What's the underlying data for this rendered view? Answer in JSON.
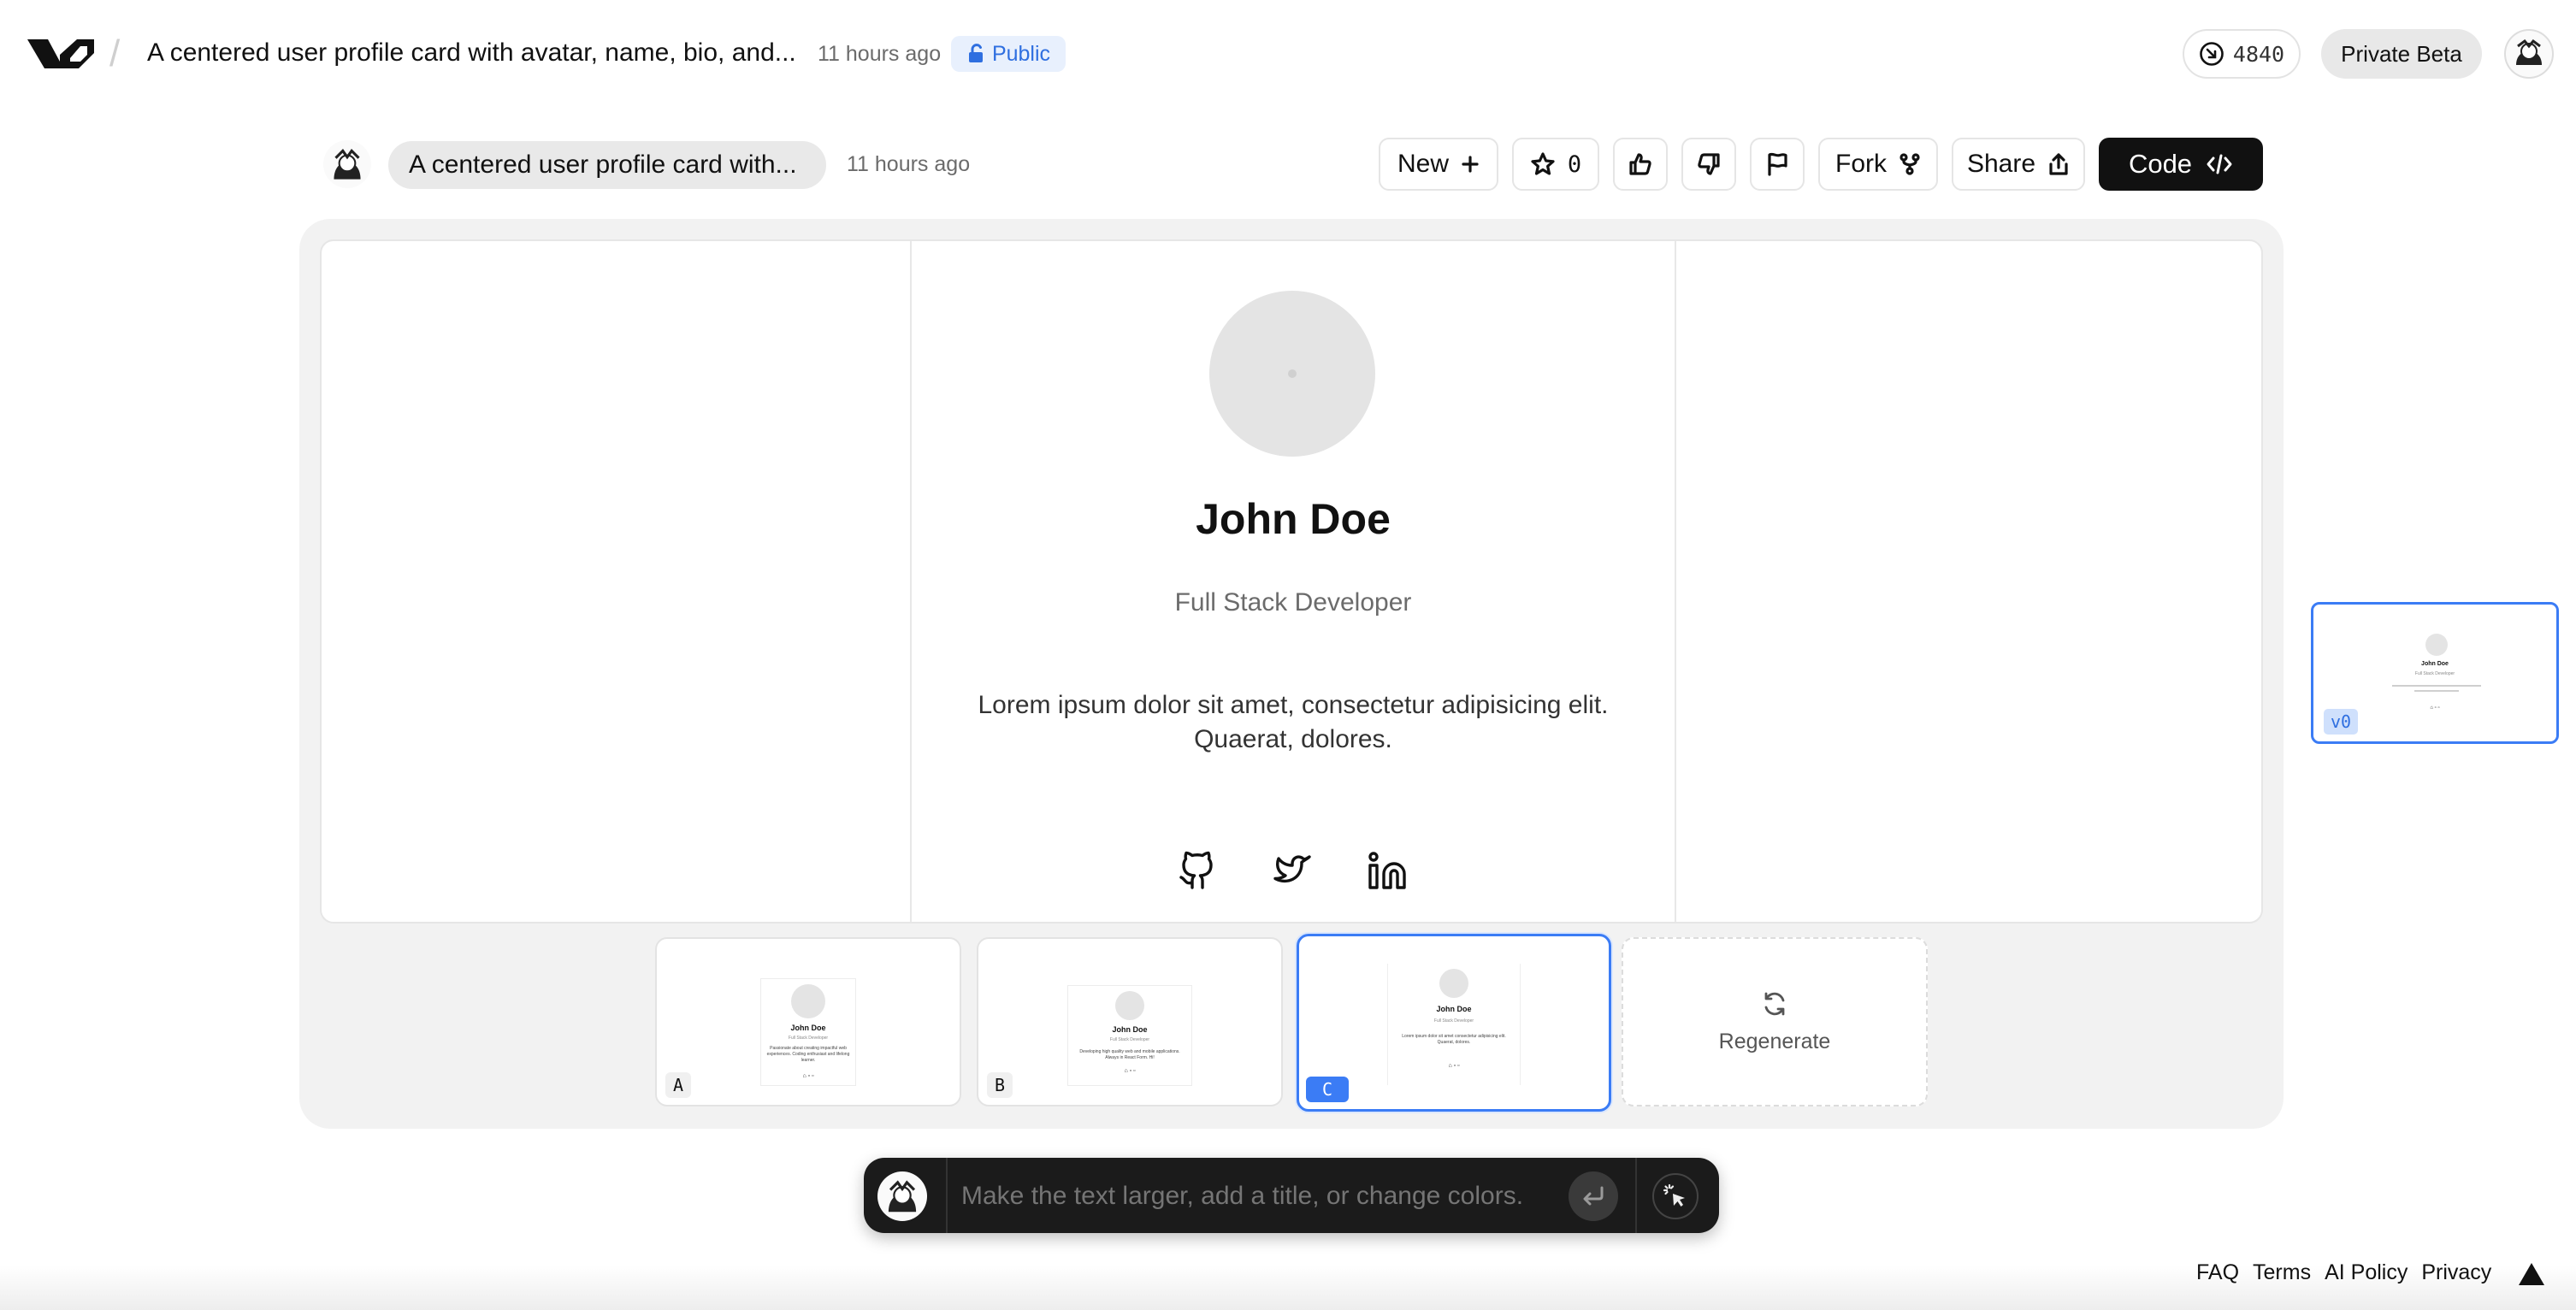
{
  "header": {
    "logo": "v0",
    "separator": "/",
    "title": "A centered user profile card with avatar, name, bio, and...",
    "time": "11 hours ago",
    "visibility": "Public",
    "credits": "4840",
    "beta_label": "Private Beta"
  },
  "toolbar": {
    "prompt_chip": "A centered user profile card with...",
    "time": "11 hours ago",
    "new_label": "New",
    "star_count": "0",
    "fork_label": "Fork",
    "share_label": "Share",
    "code_label": "Code"
  },
  "preview": {
    "name": "John Doe",
    "role": "Full Stack Developer",
    "bio_line1": "Lorem ipsum dolor sit amet, consectetur adipisicing elit.",
    "bio_line2": "Quaerat, dolores.",
    "social_icons": [
      "github-icon",
      "twitter-icon",
      "linkedin-icon"
    ]
  },
  "variants": [
    {
      "letter": "A",
      "name": "John Doe",
      "role": "Full Stack Developer",
      "bio": "Passionate about creating impactful web experiences. Coding enthusiast and lifelong learner."
    },
    {
      "letter": "B",
      "name": "John Doe",
      "role": "Full Stack Developer",
      "bio": "Developing high quality web and mobile applications. Always in React Form. Hi!"
    },
    {
      "letter": "C",
      "name": "John Doe",
      "role": "Full Stack Developer",
      "bio": "Lorem ipsum dolor sit amet consectetur adipisicing elit. Quaerat, dolores."
    }
  ],
  "regenerate_label": "Regenerate",
  "version_badge": "v0",
  "history_thumb": {
    "name": "John Doe",
    "role": "Full Stack Developer"
  },
  "prompt_input": {
    "placeholder": "Make the text larger, add a title, or change colors."
  },
  "footer": {
    "links": [
      "FAQ",
      "Terms",
      "AI Policy",
      "Privacy"
    ]
  },
  "colors": {
    "accent": "#3b7cf5",
    "dark": "#111111",
    "panel": "#f2f2f2",
    "public_bg": "#e8f0fd",
    "public_text": "#2f6fe0"
  }
}
